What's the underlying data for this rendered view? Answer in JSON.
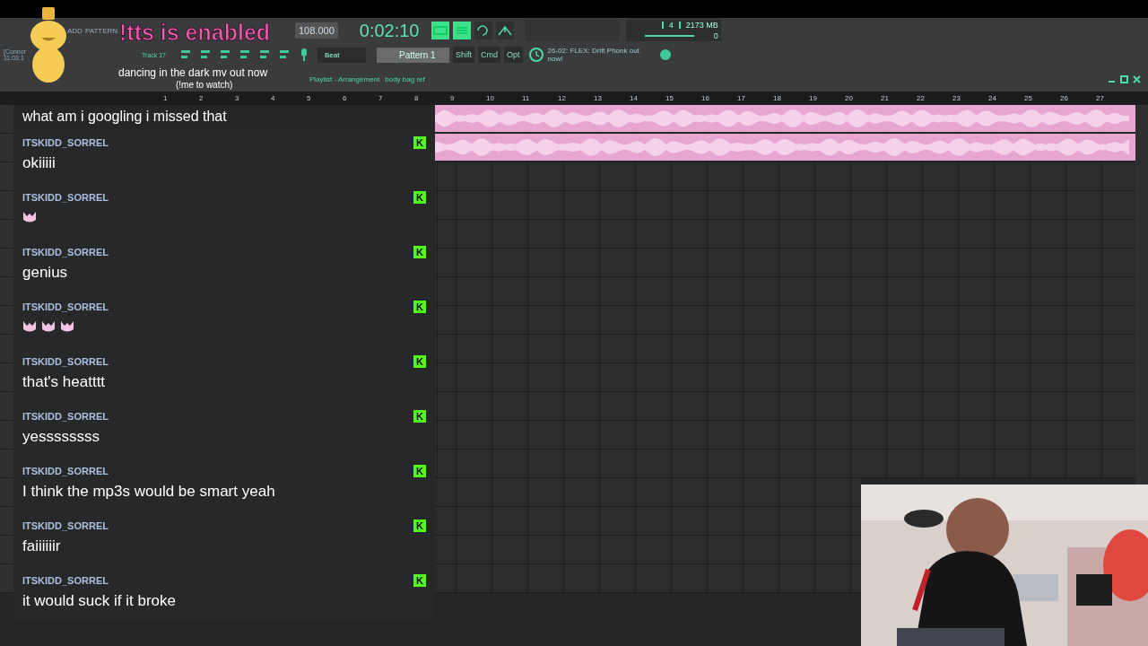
{
  "menu": [
    "ADD",
    "PATTERN"
  ],
  "clock": {
    "name": "[Connor",
    "time": "11:03:1"
  },
  "tempo": "108.000",
  "time": "0:02:10",
  "hint": "Track 17",
  "snap": "Beat",
  "pattern": "Pattern 1",
  "modifiers": [
    "Shift",
    "Cmd",
    "Opt"
  ],
  "news": "26-02: FLEX: Drift Phonk out now!",
  "monitor": {
    "cpu": "4",
    "memory": "2173 MB",
    "voices": "0"
  },
  "playlist": {
    "breadcrumb": [
      "Playlist - Arrangement",
      "body bag ref"
    ],
    "ruler": [
      "1",
      "2",
      "3",
      "4",
      "5",
      "6",
      "7",
      "8",
      "9",
      "10",
      "11",
      "12",
      "13",
      "14",
      "15",
      "16",
      "17",
      "18",
      "19",
      "20",
      "21",
      "22",
      "23",
      "24",
      "25",
      "26",
      "27"
    ],
    "tracks": [
      {
        "kind": "audio"
      },
      {
        "kind": "audio"
      },
      {
        "kind": "empty"
      },
      {
        "kind": "empty"
      },
      {
        "kind": "empty"
      },
      {
        "kind": "empty"
      },
      {
        "kind": "empty"
      },
      {
        "kind": "empty"
      },
      {
        "kind": "empty"
      },
      {
        "kind": "empty"
      },
      {
        "kind": "empty"
      },
      {
        "kind": "empty"
      },
      {
        "kind": "empty"
      },
      {
        "kind": "empty"
      },
      {
        "kind": "empty"
      },
      {
        "kind": "empty"
      },
      {
        "kind": "empty"
      }
    ]
  },
  "alerts": {
    "title": "!tts is enabled",
    "ticker": "dancing in the dark mv out now",
    "subtext": "(!me to watch)"
  },
  "chat": {
    "partial": "what am i googling i missed that",
    "messages": [
      {
        "user": "ITSKIDD_SORREL",
        "badge": "K",
        "text": "okiiiii"
      },
      {
        "user": "ITSKIDD_SORREL",
        "badge": "K",
        "emotes": [
          {
            "kind": "cat"
          }
        ]
      },
      {
        "user": "ITSKIDD_SORREL",
        "badge": "K",
        "text": "genius"
      },
      {
        "user": "ITSKIDD_SORREL",
        "badge": "K",
        "emotes": [
          {
            "kind": "cat"
          },
          {
            "kind": "cat"
          },
          {
            "kind": "cat"
          }
        ]
      },
      {
        "user": "ITSKIDD_SORREL",
        "badge": "K",
        "text": "that's heatttt"
      },
      {
        "user": "ITSKIDD_SORREL",
        "badge": "K",
        "text": "yessssssss"
      },
      {
        "user": "ITSKIDD_SORREL",
        "badge": "K",
        "text": "I think the mp3s would be smart yeah"
      },
      {
        "user": "ITSKIDD_SORREL",
        "badge": "K",
        "text": "faiiiiiir"
      },
      {
        "user": "ITSKIDD_SORREL",
        "badge": "K",
        "text": "it would suck if it broke"
      }
    ]
  },
  "webcam": {
    "kind": "picture"
  }
}
